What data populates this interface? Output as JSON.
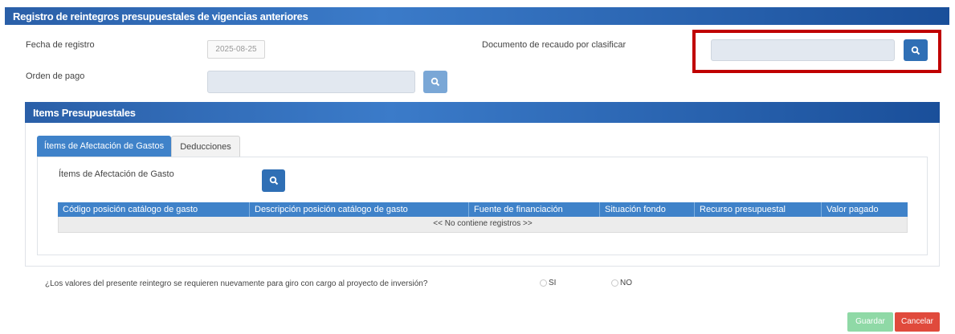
{
  "header": {
    "title": "Registro de reintegros presupuestales de vigencias anteriores"
  },
  "form": {
    "fecha_label": "Fecha de registro",
    "fecha_value": "2025-08-25",
    "documento_label": "Documento de recaudo por clasificar",
    "orden_label": "Orden de pago"
  },
  "items": {
    "title": "Items Presupuestales",
    "tabs": [
      {
        "label": "Ítems de Afectación de Gastos",
        "active": true
      },
      {
        "label": "Deducciones",
        "active": false
      }
    ],
    "panel_label": "Ítems de Afectación de Gasto",
    "columns": [
      "Código posición catálogo de gasto",
      "Descripción posición catálogo de gasto",
      "Fuente de financiación",
      "Situación fondo",
      "Recurso presupuestal",
      "Valor pagado"
    ],
    "empty_text": "<< No contiene registros >>"
  },
  "question": {
    "text": "¿Los valores del presente reintegro se requieren nuevamente para giro con cargo al proyecto de inversión?",
    "option_si": "SI",
    "option_no": "NO"
  },
  "actions": {
    "save_label": "Guardar",
    "cancel_label": "Cancelar"
  },
  "colors": {
    "primary": "#2f6fb5",
    "highlight": "#c00000",
    "save": "#8fd9a6",
    "cancel": "#e04a3c"
  }
}
